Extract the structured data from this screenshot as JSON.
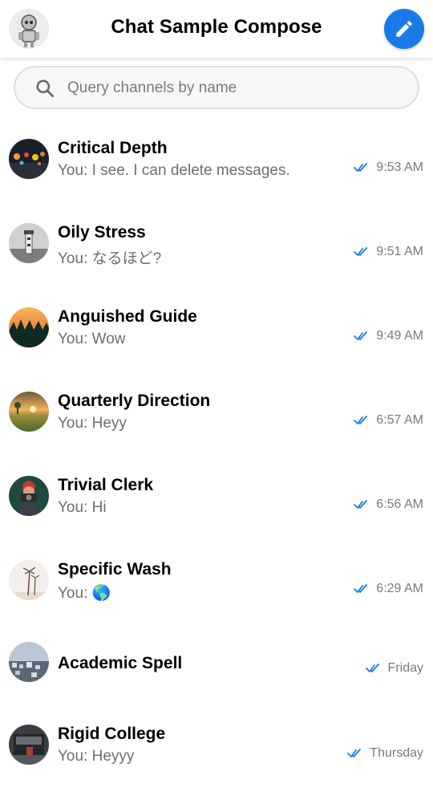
{
  "header": {
    "title": "Chat Sample Compose"
  },
  "search": {
    "placeholder": "Query channels by name",
    "value": ""
  },
  "colors": {
    "accent": "#1b7ae8",
    "read_check": "#1b7ae8"
  },
  "icons": {
    "compose": "pencil-icon",
    "search": "search-icon",
    "read_status": "double-check-icon"
  },
  "channels": [
    {
      "name": "Critical Depth",
      "preview": "You: I see. I can delete messages.",
      "time": "9:53 AM"
    },
    {
      "name": "Oily Stress",
      "preview": "You: なるほど?",
      "time": "9:51 AM"
    },
    {
      "name": "Anguished Guide",
      "preview": "You: Wow",
      "time": "9:49 AM"
    },
    {
      "name": "Quarterly Direction",
      "preview": "You: Heyy",
      "time": "6:57 AM"
    },
    {
      "name": "Trivial Clerk",
      "preview": "You: Hi",
      "time": "6:56 AM"
    },
    {
      "name": "Specific Wash",
      "preview": "You: 🌎",
      "time": "6:29 AM"
    },
    {
      "name": "Academic Spell",
      "preview": "",
      "time": "Friday"
    },
    {
      "name": "Rigid College",
      "preview": "You: Heyyy",
      "time": "Thursday"
    }
  ]
}
